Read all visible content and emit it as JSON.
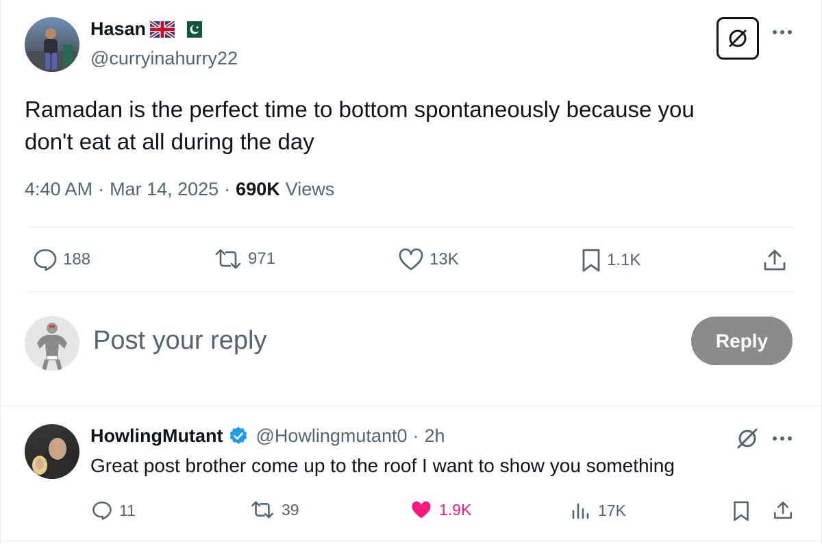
{
  "main_post": {
    "author_name": "Hasan",
    "handle": "@curryinahurry22",
    "text_line1": "Ramadan is the perfect time to bottom spontaneously because you",
    "text_line2": "don't eat at all during the day",
    "time": "4:40 AM",
    "sep1": "·",
    "date": "Mar 14, 2025",
    "sep2": "·",
    "views_count": "690K",
    "views_label": "Views",
    "stats": {
      "replies": "188",
      "reposts": "971",
      "likes": "13K",
      "bookmarks": "1.1K"
    }
  },
  "composer": {
    "placeholder": "Post your reply",
    "reply_label": "Reply"
  },
  "reply_post": {
    "author_name": "HowlingMutant",
    "handle": "@Howlingmutant0",
    "sep": "·",
    "age": "2h",
    "text": "Great post brother come up to the roof I want to show you something",
    "stats": {
      "replies": "11",
      "reposts": "39",
      "likes": "1.9K",
      "views": "17K"
    }
  },
  "colors": {
    "text": "#0f1419",
    "muted": "#536471",
    "like_active": "#f91880",
    "verified": "#1d9bf0",
    "reply_button": "#8b8b8b"
  },
  "icons": [
    "grok-icon",
    "more-icon",
    "reply-icon",
    "repost-icon",
    "like-icon",
    "bookmark-icon",
    "share-icon",
    "views-icon",
    "verified-badge-icon",
    "uk-flag-icon",
    "pakistan-flag-icon"
  ]
}
